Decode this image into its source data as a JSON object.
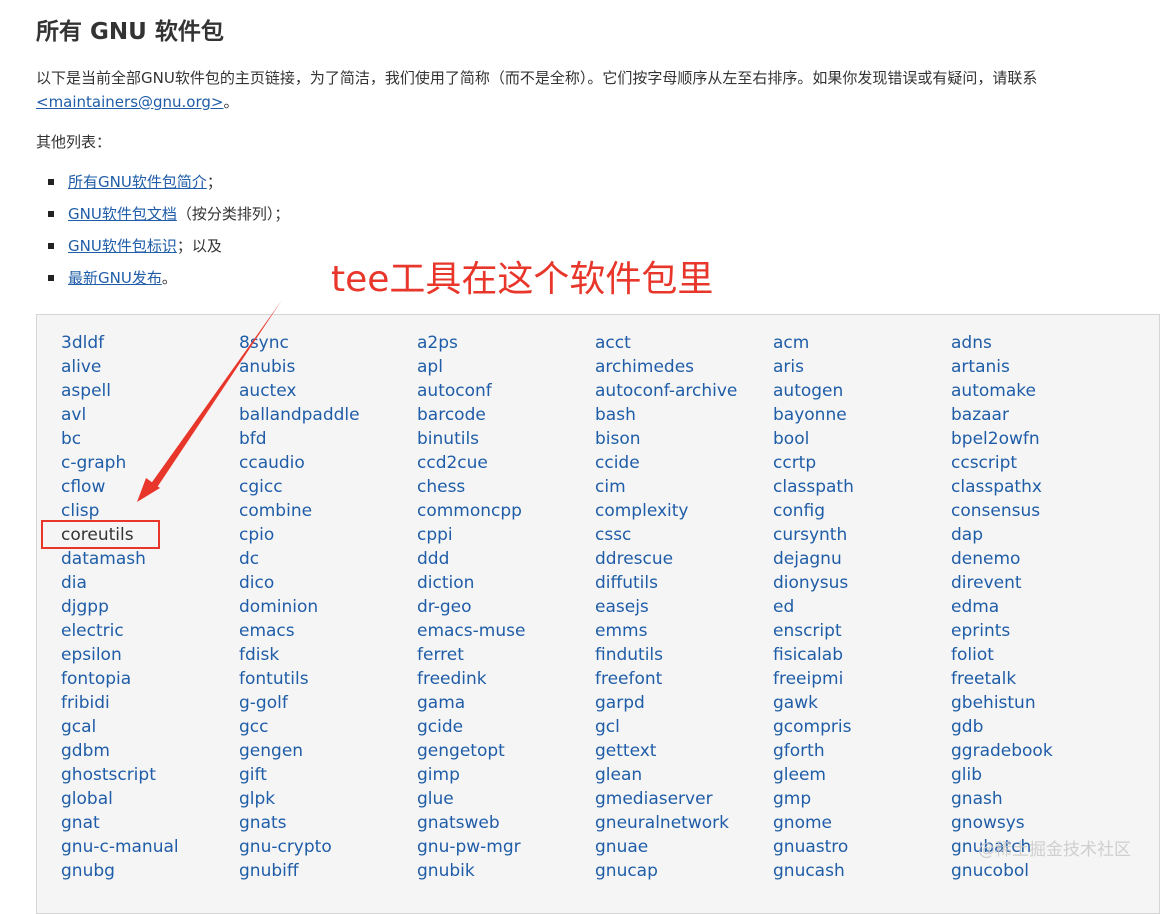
{
  "title": "所有 GNU 软件包",
  "intro": {
    "text": "以下是当前全部GNU软件包的主页链接，为了简洁，我们使用了简称（而不是全称）。它们按字母顺序从左至右排序。如果你发现错误或有疑问，请联系",
    "email": "<maintainers@gnu.org>",
    "end": "。"
  },
  "other_label": "其他列表：",
  "other_lists": [
    {
      "link": "所有GNU软件包简介",
      "suffix": "；"
    },
    {
      "link": "GNU软件包文档",
      "suffix": "（按分类排列）；"
    },
    {
      "link": "GNU软件包标识",
      "suffix": "；以及"
    },
    {
      "link": "最新GNU发布",
      "suffix": "。"
    }
  ],
  "annotation": "tee工具在这个软件包里",
  "highlighted_package": "coreutils",
  "packages": [
    "3dldf",
    "8sync",
    "a2ps",
    "acct",
    "acm",
    "adns",
    "alive",
    "anubis",
    "apl",
    "archimedes",
    "aris",
    "artanis",
    "aspell",
    "auctex",
    "autoconf",
    "autoconf-archive",
    "autogen",
    "automake",
    "avl",
    "ballandpaddle",
    "barcode",
    "bash",
    "bayonne",
    "bazaar",
    "bc",
    "bfd",
    "binutils",
    "bison",
    "bool",
    "bpel2owfn",
    "c-graph",
    "ccaudio",
    "ccd2cue",
    "ccide",
    "ccrtp",
    "ccscript",
    "cflow",
    "cgicc",
    "chess",
    "cim",
    "classpath",
    "classpathx",
    "clisp",
    "combine",
    "commoncpp",
    "complexity",
    "config",
    "consensus",
    "coreutils",
    "cpio",
    "cppi",
    "cssc",
    "cursynth",
    "dap",
    "datamash",
    "dc",
    "ddd",
    "ddrescue",
    "dejagnu",
    "denemo",
    "dia",
    "dico",
    "diction",
    "diffutils",
    "dionysus",
    "direvent",
    "djgpp",
    "dominion",
    "dr-geo",
    "easejs",
    "ed",
    "edma",
    "electric",
    "emacs",
    "emacs-muse",
    "emms",
    "enscript",
    "eprints",
    "epsilon",
    "fdisk",
    "ferret",
    "findutils",
    "fisicalab",
    "foliot",
    "fontopia",
    "fontutils",
    "freedink",
    "freefont",
    "freeipmi",
    "freetalk",
    "fribidi",
    "g-golf",
    "gama",
    "garpd",
    "gawk",
    "gbehistun",
    "gcal",
    "gcc",
    "gcide",
    "gcl",
    "gcompris",
    "gdb",
    "gdbm",
    "gengen",
    "gengetopt",
    "gettext",
    "gforth",
    "ggradebook",
    "ghostscript",
    "gift",
    "gimp",
    "glean",
    "gleem",
    "glib",
    "global",
    "glpk",
    "glue",
    "gmediaserver",
    "gmp",
    "gnash",
    "gnat",
    "gnats",
    "gnatsweb",
    "gneuralnetwork",
    "gnome",
    "gnowsys",
    "gnu-c-manual",
    "gnu-crypto",
    "gnu-pw-mgr",
    "gnuae",
    "gnuastro",
    "gnubatch",
    "gnubg",
    "gnubiff",
    "gnubik",
    "gnucap",
    "gnucash",
    "gnucobol"
  ],
  "watermark": "@稀土掘金技术社区",
  "colors": {
    "link": "#1f5da8",
    "annotation": "#e8362b",
    "box_bg": "#f5f5f5"
  }
}
